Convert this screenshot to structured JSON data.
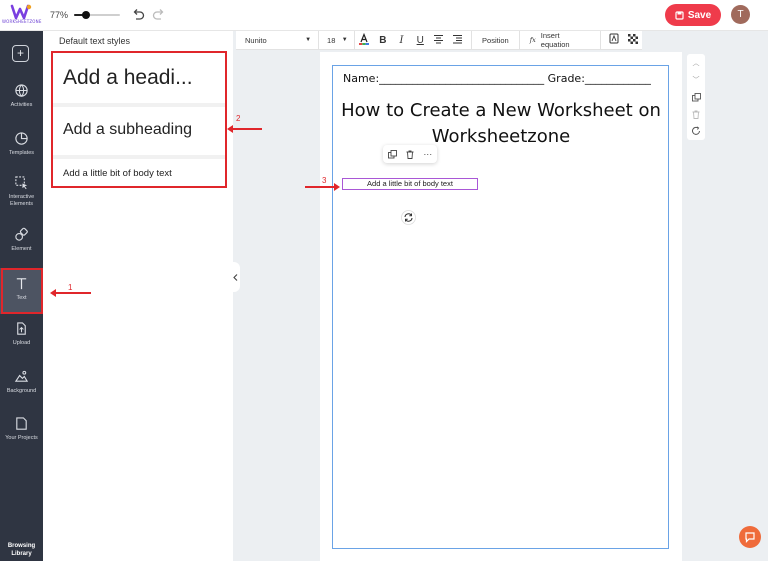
{
  "header": {
    "logo_text": "WORKSHEETZONE",
    "zoom_label": "77%",
    "zoom_value": 0.25,
    "save_label": "Save",
    "avatar_initial": "T"
  },
  "sidebar": {
    "items": [
      {
        "label": "Activities",
        "icon": "globe-icon"
      },
      {
        "label": "Templates",
        "icon": "templates-icon"
      },
      {
        "label": "Interactive Elements",
        "icon": "interactive-icon"
      },
      {
        "label": "Element",
        "icon": "shapes-icon"
      },
      {
        "label": "Text",
        "icon": "text-icon"
      },
      {
        "label": "Upload",
        "icon": "upload-icon"
      },
      {
        "label": "Background",
        "icon": "background-icon"
      },
      {
        "label": "Your Projects",
        "icon": "folder-icon"
      }
    ],
    "active": "Text",
    "browsing_label": "Browsing Library"
  },
  "panel": {
    "title": "Default text styles",
    "heading": "Add a headi...",
    "subheading": "Add a subheading",
    "body": "Add a little bit of body text"
  },
  "annotations": {
    "n1": "1",
    "n2": "2",
    "n3": "3"
  },
  "toolbar": {
    "font": "Nunito",
    "size": "18",
    "position_label": "Position",
    "fx_label": "fx",
    "equation_label": "Insert equation"
  },
  "worksheet": {
    "name_line": "Name:______________________________  Grade:____________",
    "title": "How to Create a New Worksheet on Worksheetzone",
    "text_element": "Add a little bit of body text"
  },
  "colors": {
    "save": "#ef3b4b",
    "highlight": "#e0262b",
    "sheet_border": "#6aa3e6",
    "selection": "#a957d6",
    "sidebar": "#2f3542"
  }
}
